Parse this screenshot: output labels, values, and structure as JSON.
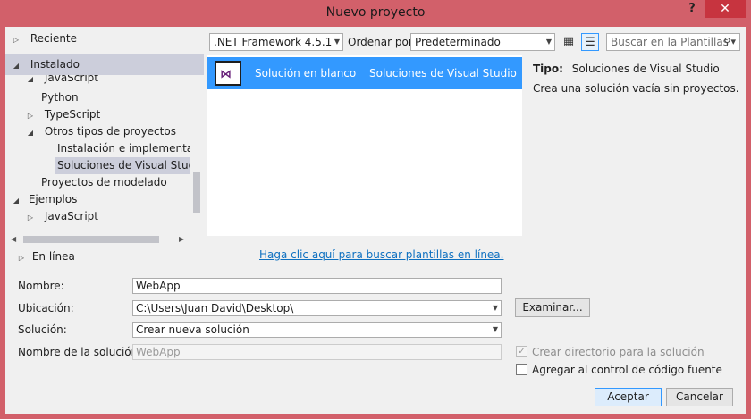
{
  "window": {
    "title": "Nuevo proyecto",
    "help_label": "?",
    "close_label": "✕"
  },
  "tree": {
    "recent": "Reciente",
    "installed": "Instalado",
    "items": [
      {
        "label": "JavaScript"
      },
      {
        "label": "Python"
      },
      {
        "label": "TypeScript"
      },
      {
        "label": "Otros tipos de proyectos"
      },
      {
        "label": "Instalación e implementación"
      },
      {
        "label": "Soluciones de Visual Studio"
      },
      {
        "label": "Proyectos de modelado"
      },
      {
        "label": "Ejemplos"
      },
      {
        "label": "JavaScript"
      }
    ],
    "online": "En línea"
  },
  "toolbar": {
    "framework": ".NET Framework 4.5.1",
    "sort_label": "Ordenar por:",
    "sort_value": "Predeterminado",
    "search_placeholder": "Buscar en la Plantillas"
  },
  "templates": [
    {
      "name": "Solución en blanco",
      "category": "Soluciones de Visual Studio",
      "icon": "visual-studio-solution-icon"
    }
  ],
  "details": {
    "type_label": "Tipo:",
    "type_value": "Soluciones de Visual Studio",
    "description": "Crea una solución vacía sin proyectos."
  },
  "online_link": "Haga clic aquí para buscar plantillas en línea.",
  "form": {
    "name_label": "Nombre:",
    "name_value": "WebApp",
    "location_label": "Ubicación:",
    "location_value": "C:\\Users\\Juan David\\Desktop\\",
    "browse_label": "Examinar...",
    "solution_label": "Solución:",
    "solution_value": "Crear nueva solución",
    "solution_name_label": "Nombre de la solución:",
    "solution_name_value": "WebApp",
    "create_dir_label": "Crear directorio para la solución",
    "source_control_label": "Agregar al control de código fuente"
  },
  "buttons": {
    "accept": "Aceptar",
    "cancel": "Cancelar"
  },
  "colors": {
    "accent": "#3399ff",
    "titlebar": "#d2606a",
    "close": "#c7343f"
  }
}
